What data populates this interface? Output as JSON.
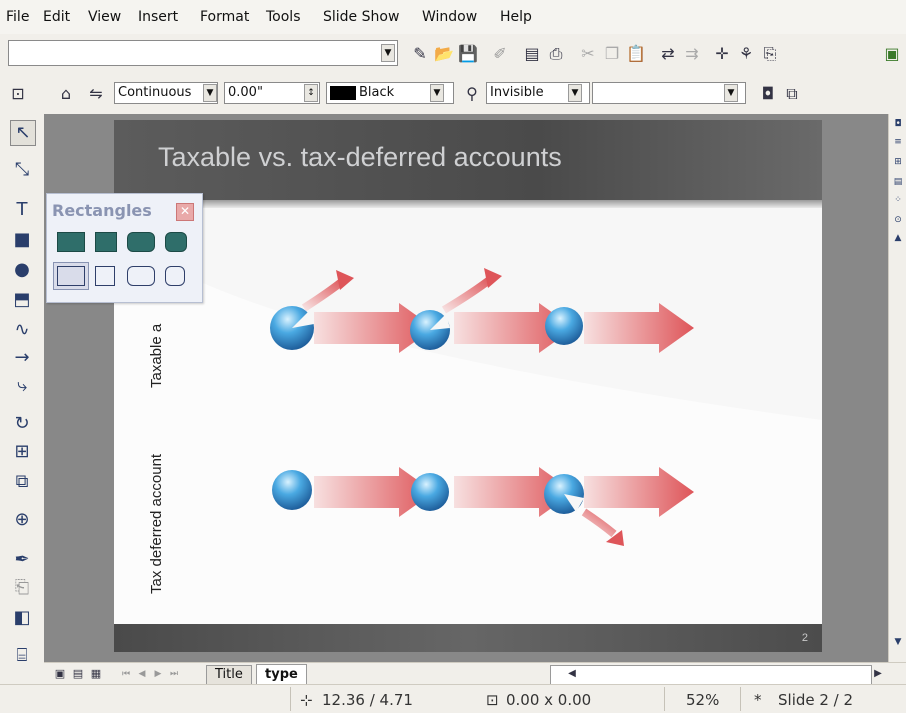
{
  "menu": {
    "items": [
      {
        "label": "File",
        "id": "file"
      },
      {
        "label": "Edit",
        "id": "edit"
      },
      {
        "label": "View",
        "id": "view"
      },
      {
        "label": "Insert",
        "id": "insert"
      },
      {
        "label": "Format",
        "id": "format"
      },
      {
        "label": "Tools",
        "id": "tools"
      },
      {
        "label": "Slide Show",
        "id": "slide-show"
      },
      {
        "label": "Window",
        "id": "window"
      },
      {
        "label": "Help",
        "id": "help"
      }
    ]
  },
  "toolbar": {
    "url_value": "",
    "line_style": "Continuous",
    "line_width": "0.00\"",
    "line_color": "Black",
    "line_color_swatch": "#000000",
    "area_style": "Invisible",
    "area_value": ""
  },
  "palette": {
    "title": "Rectangles",
    "close_glyph": "✕"
  },
  "slide": {
    "title": "Taxable vs. tax-deferred accounts",
    "row1_label": "Taxable a",
    "row2_label": "Tax deferred account",
    "page_number": "2"
  },
  "tabs": {
    "items": [
      {
        "label": "Title",
        "active": false
      },
      {
        "label": "type",
        "active": true
      }
    ]
  },
  "status": {
    "position": "12.36 / 4.71",
    "size": "0.00 x 0.00",
    "zoom": "52%",
    "modified": "*",
    "slide": "Slide 2 / 2"
  },
  "colors": {
    "accent_blue": "#2f7fd0",
    "arrow_red": "#e0595b"
  }
}
